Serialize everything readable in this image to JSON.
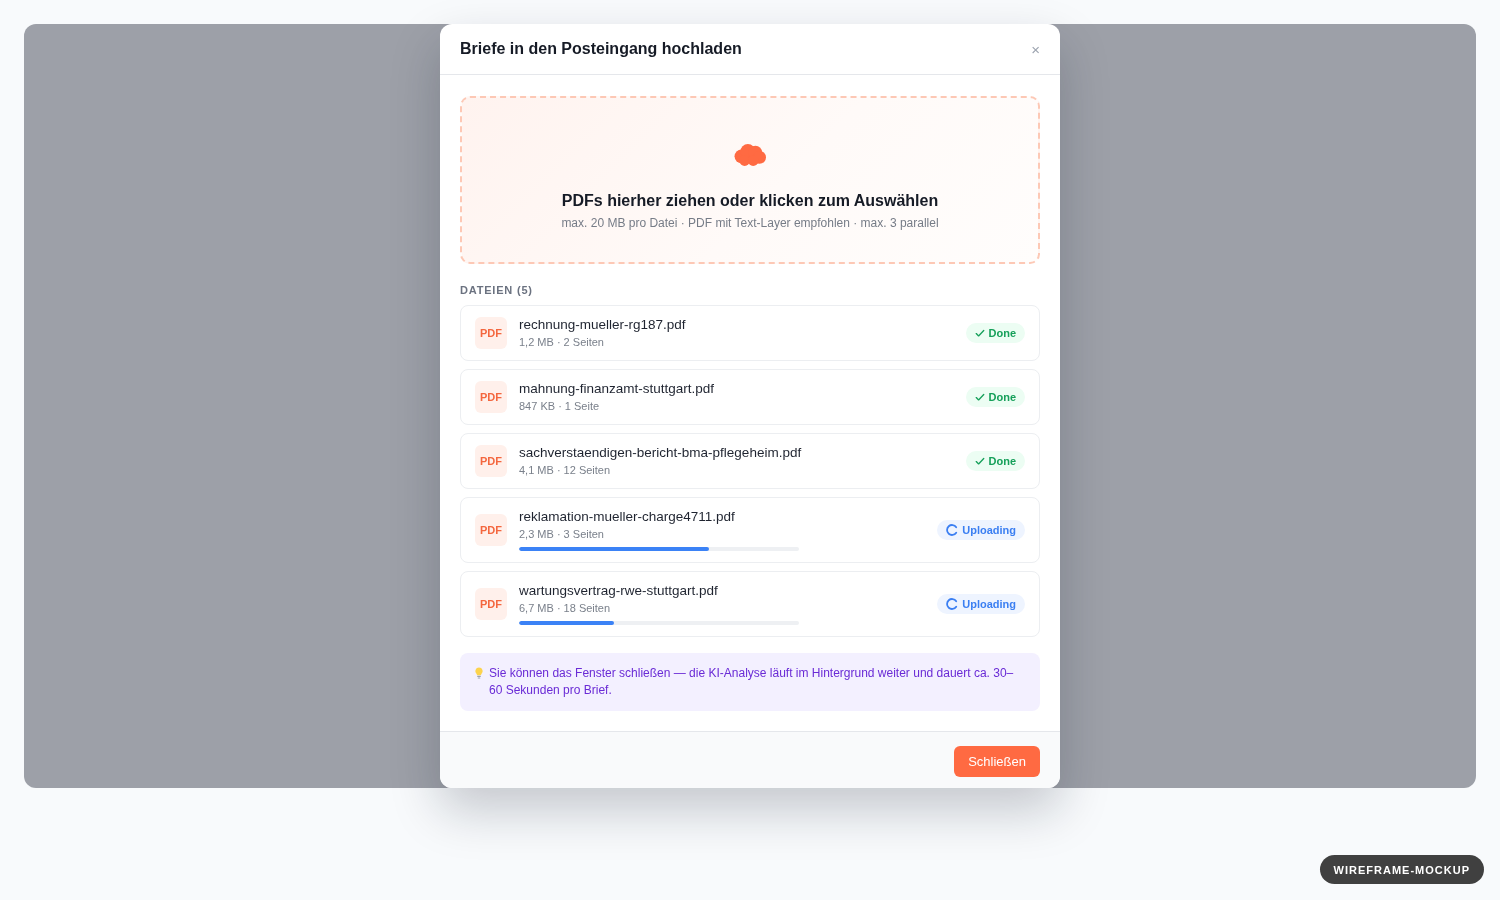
{
  "dialog": {
    "title": "Briefe in den Posteingang hochladen",
    "close": "×",
    "dropzone": {
      "title": "PDFs hierher ziehen oder klicken zum Auswählen",
      "hint": "max. 20 MB pro Datei · PDF mit Text-Layer empfohlen · max. 3 parallel"
    },
    "files": {
      "heading": "DATEIEN (5)",
      "items": [
        {
          "type_label": "PDF",
          "name": "rechnung-mueller-rg187.pdf",
          "meta": "1,2 MB · 2 Seiten",
          "kind": "done",
          "status": "Done"
        },
        {
          "type_label": "PDF",
          "name": "mahnung-finanzamt-stuttgart.pdf",
          "meta": "847 KB · 1 Seite",
          "kind": "done",
          "status": "Done"
        },
        {
          "type_label": "PDF",
          "name": "sachverstaendigen-bericht-bma-pflegeheim.pdf",
          "meta": "4,1 MB · 12 Seiten",
          "kind": "done",
          "status": "Done"
        },
        {
          "type_label": "PDF",
          "name": "reklamation-mueller-charge4711.pdf",
          "meta": "2,3 MB · 3 Seiten",
          "kind": "uploading",
          "status": "Uploading",
          "level": 0.68
        },
        {
          "type_label": "PDF",
          "name": "wartungsvertrag-rwe-stuttgart.pdf",
          "meta": "6,7 MB · 18 Seiten",
          "kind": "uploading",
          "status": "Uploading",
          "level": 0.34
        }
      ]
    },
    "note": "Sie können das Fenster schließen — die KI-Analyse läuft im Hintergrund weiter und dauert ca. 30–60 Sekunden pro Brief.",
    "buttons": [
      "Schließen"
    ]
  },
  "badge": "WIREFRAME-MOCKUP"
}
